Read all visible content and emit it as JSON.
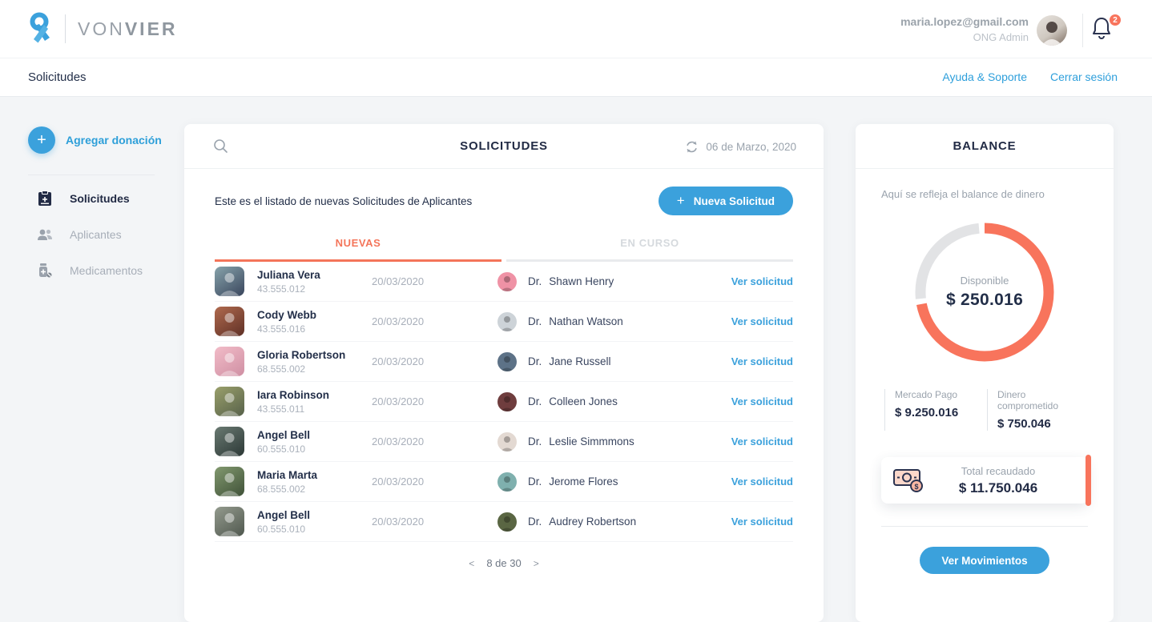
{
  "brand": {
    "name_light": "VON",
    "name_bold": "VIER",
    "logo_color": "#3ba1dc"
  },
  "header": {
    "email": "maria.lopez@gmail.com",
    "role": "ONG Admin",
    "notification_count": "2",
    "badge_color": "#f8745c"
  },
  "nav": {
    "breadcrumb": "Solicitudes",
    "help_link": "Ayuda & Soporte",
    "logout_link": "Cerrar sesión"
  },
  "sidebar": {
    "add_donation_label": "Agregar donación",
    "items": [
      {
        "label": "Solicitudes",
        "icon": "clipboard-icon",
        "active": true
      },
      {
        "label": "Aplicantes",
        "icon": "people-icon",
        "active": false
      },
      {
        "label": "Medicamentos",
        "icon": "medicine-icon",
        "active": false
      }
    ]
  },
  "solicitudes": {
    "title": "SOLICITUDES",
    "date": "06 de Marzo, 2020",
    "subtitle": "Este es el listado de nuevas Solicitudes de Aplicantes",
    "new_button_label": "Nueva Solicitud",
    "tabs": [
      {
        "label": "NUEVAS",
        "active": true
      },
      {
        "label": "EN CURSO",
        "active": false
      }
    ],
    "rows": [
      {
        "name": "Juliana Vera",
        "id": "43.555.012",
        "date": "20/03/2020",
        "doctor_prefix": "Dr.",
        "doctor": "Shawn Henry",
        "action": "Ver solicitud",
        "avatar_colors": [
          "#87a3ab",
          "#39455c"
        ],
        "doctor_avatar_color": "#ef92a5"
      },
      {
        "name": "Cody Webb",
        "id": "43.555.016",
        "date": "20/03/2020",
        "doctor_prefix": "Dr.",
        "doctor": "Nathan Watson",
        "action": "Ver solicitud",
        "avatar_colors": [
          "#b06a4e",
          "#5f3026"
        ],
        "doctor_avatar_color": "#cdd3d8"
      },
      {
        "name": "Gloria Robertson",
        "id": "68.555.002",
        "date": "20/03/2020",
        "doctor_prefix": "Dr.",
        "doctor": "Jane Russell",
        "action": "Ver solicitud",
        "avatar_colors": [
          "#f2bcc8",
          "#cf8fa3"
        ],
        "doctor_avatar_color": "#5d7287"
      },
      {
        "name": "Iara Robinson",
        "id": "43.555.011",
        "date": "20/03/2020",
        "doctor_prefix": "Dr.",
        "doctor": "Colleen Jones",
        "action": "Ver solicitud",
        "avatar_colors": [
          "#9aa06b",
          "#57614a"
        ],
        "doctor_avatar_color": "#6f3d3e"
      },
      {
        "name": "Angel Bell",
        "id": "60.555.010",
        "date": "20/03/2020",
        "doctor_prefix": "Dr.",
        "doctor": "Leslie Simmmons",
        "action": "Ver solicitud",
        "avatar_colors": [
          "#6a7a72",
          "#2c3836"
        ],
        "doctor_avatar_color": "#e3d9d2"
      },
      {
        "name": "Maria Marta",
        "id": "68.555.002",
        "date": "20/03/2020",
        "doctor_prefix": "Dr.",
        "doctor": "Jerome Flores",
        "action": "Ver solicitud",
        "avatar_colors": [
          "#82996f",
          "#3f5138"
        ],
        "doctor_avatar_color": "#7fb0ae"
      },
      {
        "name": "Angel Bell",
        "id": "60.555.010",
        "date": "20/03/2020",
        "doctor_prefix": "Dr.",
        "doctor": "Audrey Robertson",
        "action": "Ver solicitud",
        "avatar_colors": [
          "#949b8e",
          "#4f574e"
        ],
        "doctor_avatar_color": "#5a6643"
      }
    ],
    "pagination": {
      "prev": "<",
      "label": "8 de 30",
      "next": ">"
    }
  },
  "balance": {
    "title": "BALANCE",
    "subtitle": "Aquí se refleja el balance de dinero",
    "donut": {
      "label": "Disponible",
      "value": "$ 250.016",
      "percent": 72,
      "color": "#f8745c",
      "track_color": "#e2e3e5"
    },
    "stats": [
      {
        "label": "Mercado Pago",
        "value": "$ 9.250.016"
      },
      {
        "label": "Dinero comprometido",
        "value": "$ 750.046"
      }
    ],
    "total": {
      "label": "Total recaudado",
      "value": "$ 11.750.046"
    },
    "movements_button_label": "Ver Movimientos"
  }
}
